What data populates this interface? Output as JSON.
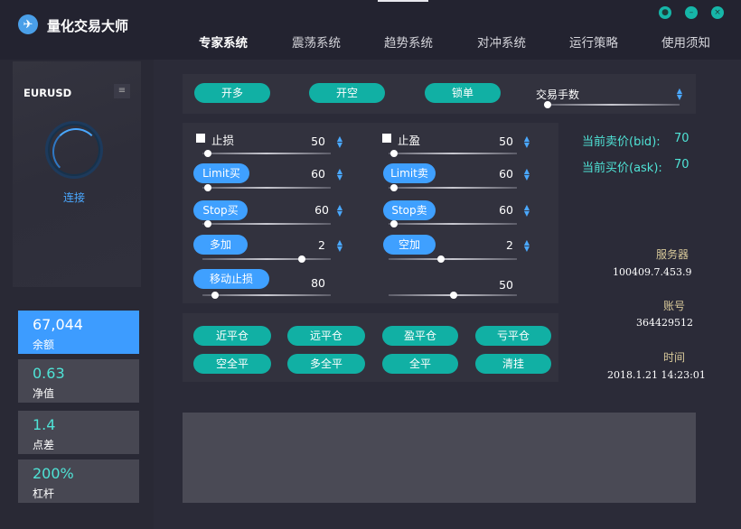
{
  "app": {
    "title": "量化交易大师",
    "logo_icon": "bird-logo-icon"
  },
  "nav": [
    "专家系统",
    "震荡系统",
    "趋势系统",
    "对冲系统",
    "运行策略",
    "使用须知"
  ],
  "sidebar": {
    "symbol": "EURUSD",
    "connect_label": "连接",
    "stats": [
      {
        "value": "67,044",
        "label": "余额"
      },
      {
        "value": "0.63",
        "label": "净值"
      },
      {
        "value": "1.4",
        "label": "点差"
      },
      {
        "value": "200%",
        "label": "杠杆"
      }
    ]
  },
  "toolbar": {
    "open_long": "开多",
    "open_short": "开空",
    "lock": "锁单",
    "lot_select": "交易手数"
  },
  "params": {
    "stop_loss": {
      "label": "止损",
      "value": "50"
    },
    "take_profit": {
      "label": "止盈",
      "value": "50"
    },
    "limit_buy": {
      "label": "Limit买",
      "value": "60"
    },
    "limit_sell": {
      "label": "Limit卖",
      "value": "60"
    },
    "stop_buy": {
      "label": "Stop买",
      "value": "60"
    },
    "stop_sell": {
      "label": "Stop卖",
      "value": "60"
    },
    "add_long": {
      "label": "多加",
      "value": "2"
    },
    "add_short": {
      "label": "空加",
      "value": "2"
    },
    "trailing_stop": {
      "label": "移动止损",
      "value": "80"
    },
    "extra": {
      "value": "50"
    }
  },
  "actions": [
    "近平仓",
    "远平仓",
    "盈平仓",
    "亏平仓",
    "空全平",
    "多全平",
    "全平",
    "清挂"
  ],
  "quotes": {
    "bid_label": "当前卖价(bid):",
    "bid_value": "70",
    "ask_label": "当前买价(ask):",
    "ask_value": "70"
  },
  "info": {
    "server_label": "服务器",
    "server_value": "100409.7.453.9",
    "account_label": "账号",
    "account_value": "364429512",
    "time_label": "时间",
    "time_value": "2018.1.21 14:23:01"
  },
  "colors": {
    "teal": "#11b0a4",
    "blue": "#3fa0ff",
    "cyan_text": "#4fe3d6",
    "bg": "#2b2b38"
  }
}
